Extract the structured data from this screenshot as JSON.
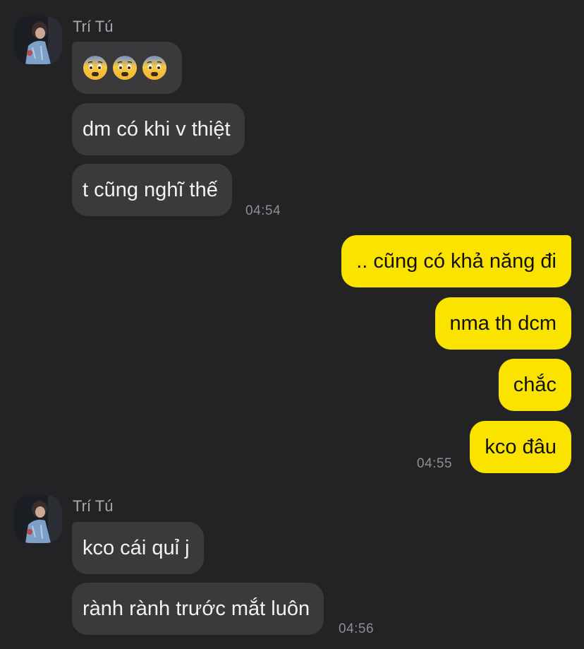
{
  "colors": {
    "background": "#232325",
    "incoming_bubble": "#3a3a3c",
    "outgoing_bubble": "#fbe300",
    "timestamp": "#8e8e93"
  },
  "group1": {
    "sender": "Trí Tú",
    "emoji_message": "fearful-face fearful-face fearful-face",
    "msg2": "dm có khi v thiệt",
    "msg3": "t cũng nghĩ thế",
    "time": "04:54"
  },
  "group2": {
    "msg1": ".. cũng có khả năng đi",
    "msg2": "nma th dcm",
    "msg3": "chắc",
    "msg4": "kco đâu",
    "time": "04:55"
  },
  "group3": {
    "sender": "Trí Tú",
    "msg1": "kco cái quỉ j",
    "msg2": "rành rành trước mắt luôn",
    "time": "04:56"
  }
}
